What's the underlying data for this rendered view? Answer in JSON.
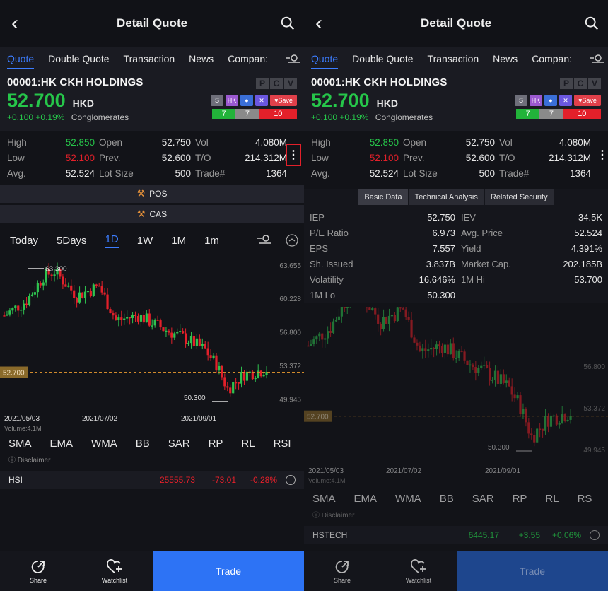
{
  "left": {
    "header": {
      "title": "Detail Quote"
    },
    "tabs": [
      "Quote",
      "Double Quote",
      "Transaction",
      "News",
      "Compan:"
    ],
    "quote": {
      "symbol": "00001:HK CKH HOLDINGS",
      "pcv": [
        "P",
        "C",
        "V"
      ],
      "price": "52.700",
      "currency": "HKD",
      "change": "+0.100",
      "change_pct": "+0.19%",
      "sector": "Conglomerates",
      "badges": [
        "S",
        "HK",
        "",
        "",
        "Save"
      ],
      "ratio": [
        "7",
        "7",
        "10"
      ]
    },
    "stats": [
      {
        "l1": "High",
        "v1": "52.850",
        "l2": "Open",
        "v2": "52.750",
        "l3": "Vol",
        "v3": "4.080M"
      },
      {
        "l1": "Low",
        "v1": "52.100",
        "l2": "Prev.",
        "v2": "52.600",
        "l3": "T/O",
        "v3": "214.312M"
      },
      {
        "l1": "Avg.",
        "v1": "52.524",
        "l2": "Lot Size",
        "v2": "500",
        "l3": "Trade#",
        "v3": "1364"
      }
    ],
    "buttons": {
      "pos": "POS",
      "cas": "CAS"
    },
    "timeframes": [
      "Today",
      "5Days",
      "1D",
      "1W",
      "1M",
      "1m"
    ],
    "chart_labels": {
      "high": "63.300",
      "low": "50.300",
      "current": "52.700",
      "axis": [
        "63.655",
        "60.228",
        "56.800",
        "53.372",
        "49.945"
      ],
      "dates": [
        "2021/05/03",
        "2021/07/02",
        "2021/09/01"
      ],
      "volume": "Volume:4.1M"
    },
    "indicators": [
      "SMA",
      "EMA",
      "WMA",
      "BB",
      "SAR",
      "RP",
      "RL",
      "RSI"
    ],
    "disclaimer": "Disclaimer",
    "index": {
      "name": "HSI",
      "value": "25555.73",
      "change": "-73.01",
      "pct": "-0.28%"
    },
    "bottom": {
      "share": "Share",
      "watchlist": "Watchlist",
      "trade": "Trade"
    }
  },
  "right": {
    "header": {
      "title": "Detail Quote"
    },
    "tabs": [
      "Quote",
      "Double Quote",
      "Transaction",
      "News",
      "Compan:"
    ],
    "quote": {
      "symbol": "00001:HK CKH HOLDINGS",
      "pcv": [
        "P",
        "C",
        "V"
      ],
      "price": "52.700",
      "currency": "HKD",
      "change": "+0.100",
      "change_pct": "+0.19%",
      "sector": "Conglomerates",
      "badges": [
        "S",
        "HK",
        "",
        "",
        "Save"
      ],
      "ratio": [
        "7",
        "7",
        "10"
      ]
    },
    "stats": [
      {
        "l1": "High",
        "v1": "52.850",
        "l2": "Open",
        "v2": "52.750",
        "l3": "Vol",
        "v3": "4.080M"
      },
      {
        "l1": "Low",
        "v1": "52.100",
        "l2": "Prev.",
        "v2": "52.600",
        "l3": "T/O",
        "v3": "214.312M"
      },
      {
        "l1": "Avg.",
        "v1": "52.524",
        "l2": "Lot Size",
        "v2": "500",
        "l3": "Trade#",
        "v3": "1364"
      }
    ],
    "subtabs": [
      "Basic Data",
      "Technical Analysis",
      "Related Security"
    ],
    "basic_data": [
      {
        "l1": "IEP",
        "v1": "52.750",
        "l2": "IEV",
        "v2": "34.5K"
      },
      {
        "l1": "P/E Ratio",
        "v1": "6.973",
        "l2": "Avg. Price",
        "v2": "52.524"
      },
      {
        "l1": "EPS",
        "v1": "7.557",
        "l2": "Yield",
        "v2": "4.391%"
      },
      {
        "l1": "Sh. Issued",
        "v1": "3.837B",
        "l2": "Market Cap.",
        "v2": "202.185B"
      },
      {
        "l1": "Volatility",
        "v1": "16.646%",
        "l2": "1M Hi",
        "v2": "53.700"
      },
      {
        "l1": "1M Lo",
        "v1": "50.300",
        "l2": "",
        "v2": ""
      }
    ],
    "chart_labels": {
      "low": "50.300",
      "current": "52.700",
      "axis": [
        "56.800",
        "53.372",
        "49.945"
      ],
      "dates": [
        "2021/05/03",
        "2021/07/02",
        "2021/09/01"
      ],
      "volume": "Volume:4.1M"
    },
    "indicators": [
      "SMA",
      "EMA",
      "WMA",
      "BB",
      "SAR",
      "RP",
      "RL",
      "RS"
    ],
    "disclaimer": "Disclaimer",
    "index": {
      "name": "HSTECH",
      "value": "6445.17",
      "change": "+3.55",
      "pct": "+0.06%"
    },
    "bottom": {
      "share": "Share",
      "watchlist": "Watchlist",
      "trade": "Trade"
    }
  }
}
